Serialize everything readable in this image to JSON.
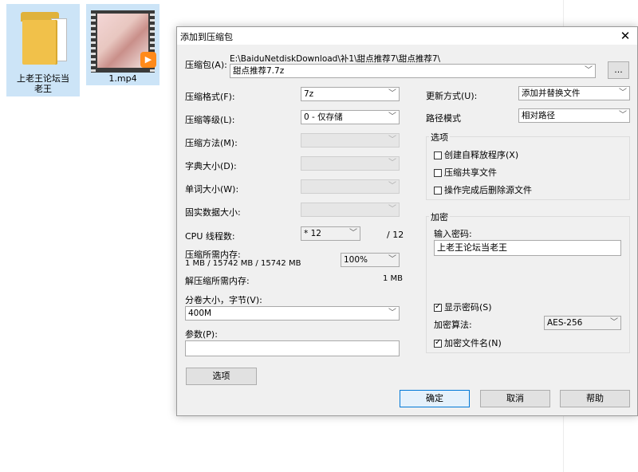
{
  "desktop": {
    "folder_label": "上老王论坛当老王",
    "video_label": "1.mp4"
  },
  "dialog": {
    "title": "添加到压缩包",
    "close": "✕",
    "archive": {
      "label": "压缩包(A):",
      "path": "E:\\BaiduNetdiskDownload\\补1\\甜点推荐7\\甜点推荐7\\",
      "filename": "甜点推荐7.7z",
      "browse": "..."
    },
    "left": {
      "format_label": "压缩格式(F):",
      "format_value": "7z",
      "level_label": "压缩等级(L):",
      "level_value": "0 - 仅存储",
      "method_label": "压缩方法(M):",
      "dict_label": "字典大小(D):",
      "word_label": "单词大小(W):",
      "solid_label": "固实数据大小:",
      "cpu_label": "CPU 线程数:",
      "cpu_value": "* 12",
      "cpu_total": "/ 12",
      "mem_label": "压缩所需内存:",
      "mem_detail": "1 MB / 15742 MB / 15742 MB",
      "mem_percent": "100%",
      "decomp_label": "解压缩所需内存:",
      "decomp_value": "1 MB",
      "volume_label": "分卷大小，字节(V):",
      "volume_value": "400M",
      "params_label": "参数(P):",
      "params_value": "",
      "options_button": "选项"
    },
    "right": {
      "update_label": "更新方式(U):",
      "update_value": "添加并替换文件",
      "pathmode_label": "路径模式",
      "pathmode_value": "相对路径",
      "options_group": "选项",
      "opt_sfx": "创建自释放程序(X)",
      "opt_shared": "压缩共享文件",
      "opt_delete": "操作完成后删除源文件",
      "encrypt_group": "加密",
      "password_label": "输入密码:",
      "password_value": "上老王论坛当老王",
      "show_password": "显示密码(S)",
      "enc_method_label": "加密算法:",
      "enc_method_value": "AES-256",
      "encrypt_names": "加密文件名(N)"
    },
    "buttons": {
      "ok": "确定",
      "cancel": "取消",
      "help": "帮助"
    }
  }
}
